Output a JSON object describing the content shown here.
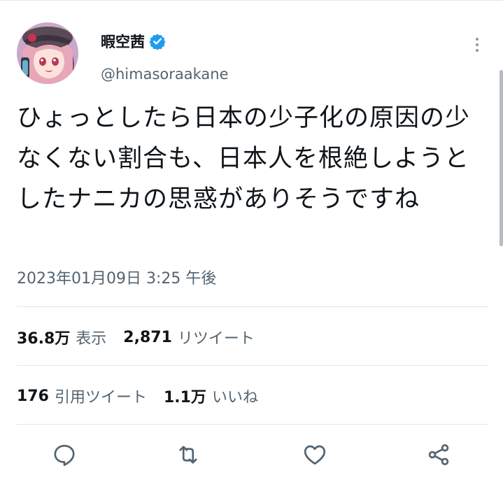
{
  "author": {
    "display_name": "暇空茜",
    "handle": "@himasoraakane",
    "verified": true,
    "verified_color": "#1d9bf0"
  },
  "tweet": {
    "text": "ひょっとしたら日本の少子化の原因の少なくない割合も、日本人を根絶しようとしたナニカの思惑がありそうですね",
    "timestamp": "2023年01月09日 3:25 午後"
  },
  "stats": {
    "views_count": "36.8万",
    "views_label": "表示",
    "retweets_count": "2,871",
    "retweets_label": "リツイート",
    "quotes_count": "176",
    "quotes_label": "引用ツイート",
    "likes_count": "1.1万",
    "likes_label": "いいね"
  },
  "icons": {
    "more": "more-options-icon",
    "reply": "reply-icon",
    "retweet": "retweet-icon",
    "like": "like-icon",
    "share": "share-icon"
  },
  "colors": {
    "text": "#0f1419",
    "secondary": "#536471",
    "divider": "#e1e5e8"
  }
}
